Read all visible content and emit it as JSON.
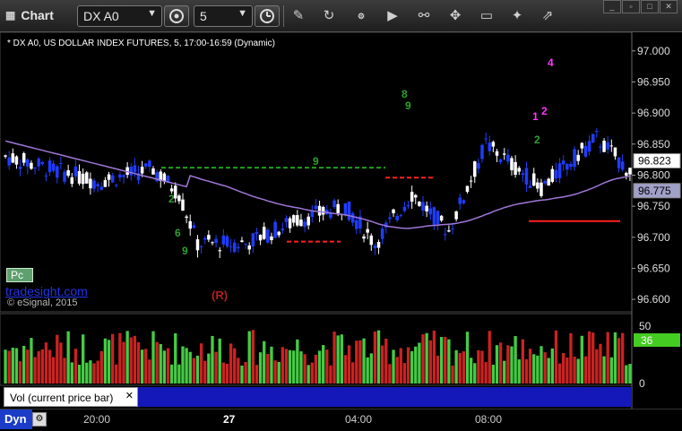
{
  "app": {
    "title": "Chart"
  },
  "toolbar": {
    "symbol": "DX A0",
    "interval": "5",
    "icons": [
      "settings-icon",
      "clock-icon",
      "pencil-icon",
      "refresh-icon",
      "gear-icon",
      "play-icon",
      "link-icon",
      "comment-icon",
      "twitter-icon",
      "pin-icon",
      "minimize-icon",
      "maximize-icon",
      "close-icon"
    ]
  },
  "chart": {
    "title": "* DX A0, US DOLLAR INDEX FUTURES, 5, 17:00-16:59 (Dynamic)",
    "price_ticks": [
      "97.000",
      "96.950",
      "96.900",
      "96.850",
      "96.800",
      "96.750",
      "96.700",
      "96.650",
      "96.600"
    ],
    "last_price": "96.823",
    "ma_price": "96.775",
    "watermark": "tradesight.com",
    "copyright": "© eSignal, 2015",
    "pc_label": "Pc",
    "r_label": "(R)",
    "colors": {
      "up": "#ffffff",
      "down": "#1f3cff",
      "ma": "#a077d8",
      "green_dash": "#1ea01e",
      "red_line": "#ff2020",
      "vol_up": "#44cc44",
      "vol_down": "#cc2222"
    }
  },
  "chart_data": {
    "type": "candlestick",
    "title": "* DX A0, US DOLLAR INDEX FUTURES, 5, 17:00-16:59 (Dynamic)",
    "ylim": [
      96.58,
      97.03
    ],
    "x_ticks": [
      "20:00",
      "27",
      "04:00",
      "08:00"
    ],
    "y_ticks": [
      97.0,
      96.95,
      96.9,
      96.85,
      96.8,
      96.75,
      96.7,
      96.65,
      96.6
    ],
    "volume_ticks": [
      "50",
      "0"
    ],
    "volume_marker": "36",
    "levels": [
      {
        "value": 96.812,
        "color": "green",
        "style": "dashed"
      },
      {
        "value": 96.796,
        "color": "red",
        "style": "dashed"
      },
      {
        "value": 96.693,
        "color": "red",
        "style": "dashed"
      },
      {
        "value": 96.726,
        "color": "red",
        "style": "solid"
      }
    ],
    "annotations": [
      "1",
      "2",
      "4",
      "8",
      "9",
      "2",
      "6",
      "9",
      "9",
      "2",
      "(R)"
    ]
  },
  "volume_panel": {
    "legend": "Vol (current price bar)",
    "ticks": [
      "50",
      "0"
    ],
    "marker": "36"
  },
  "time_axis": {
    "labels": [
      "20:00",
      "27",
      "04:00",
      "08:00"
    ],
    "bold": "27"
  },
  "bottom": {
    "dyn_label": "Dyn"
  }
}
